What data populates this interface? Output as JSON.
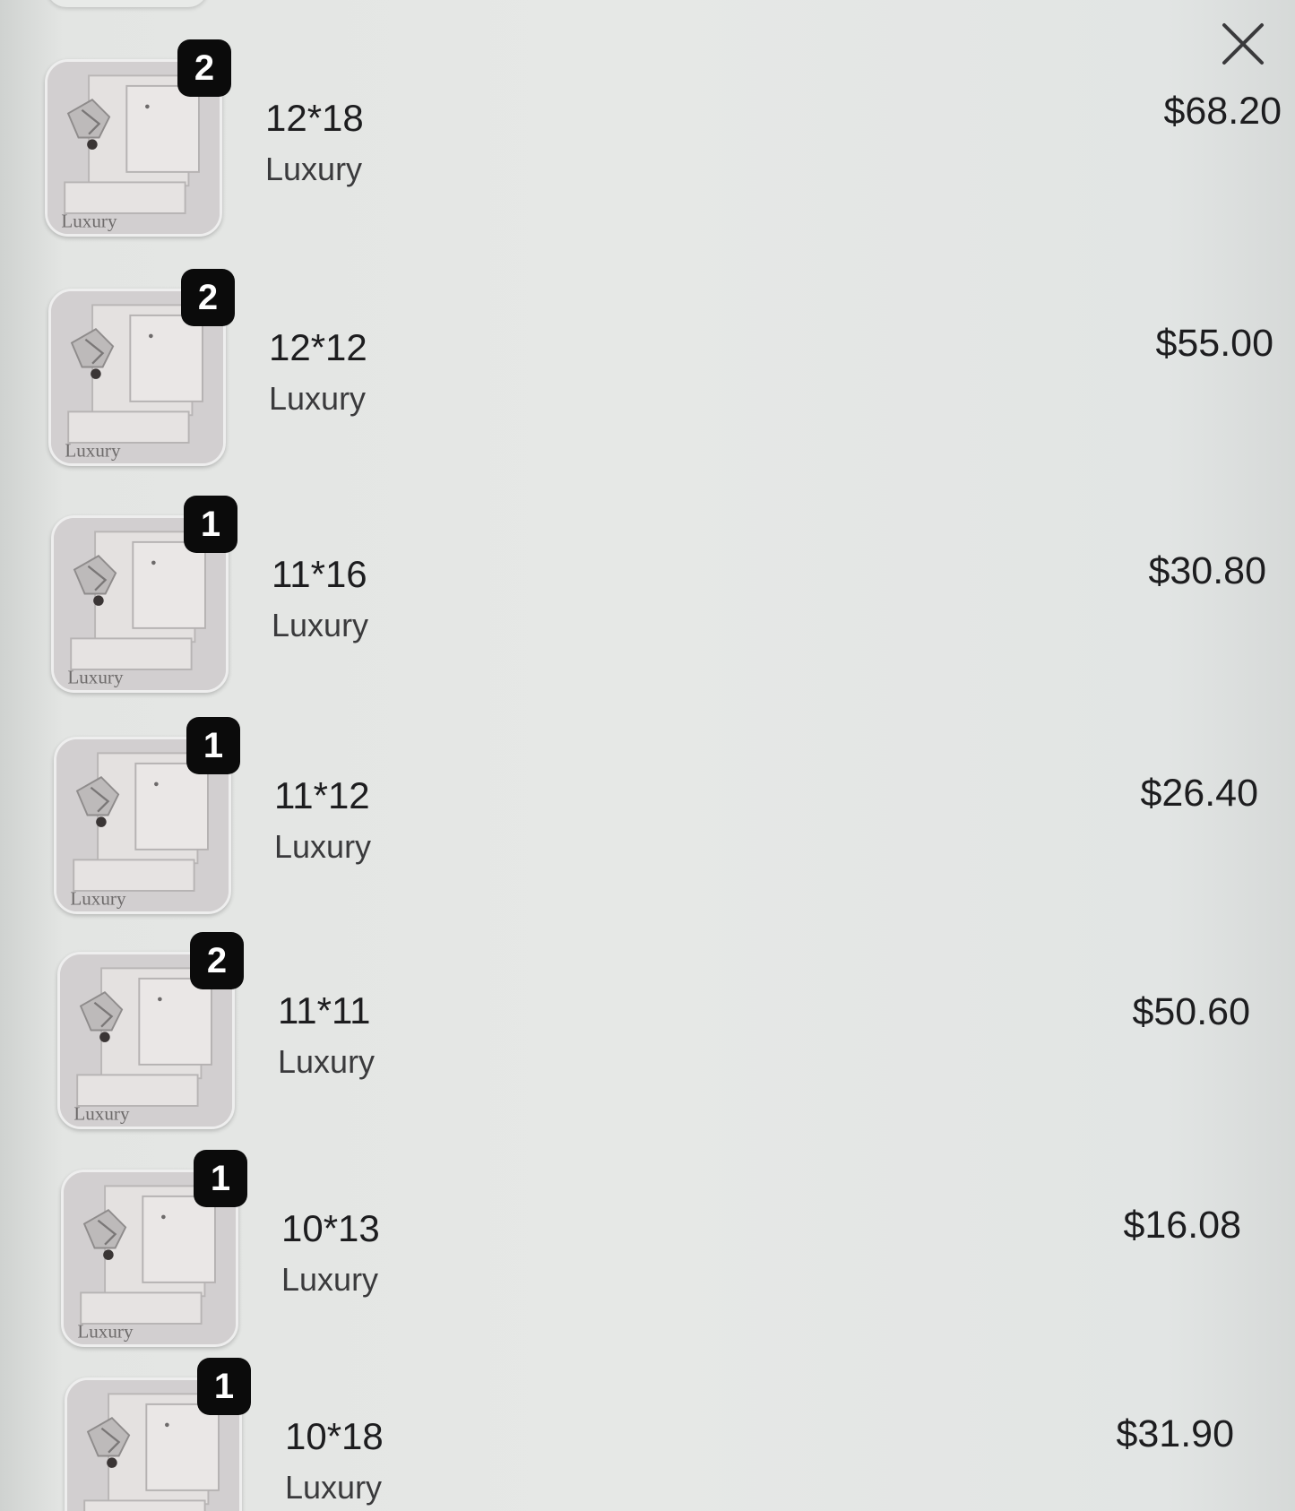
{
  "header": {
    "close_icon": "close-icon"
  },
  "thumbnail": {
    "icon": "product-thumbnail",
    "watermark_text": "Luxury"
  },
  "items": [
    {
      "size": "12*18",
      "tier": "Luxury",
      "quantity": "2",
      "price": "$68.20"
    },
    {
      "size": "12*12",
      "tier": "Luxury",
      "quantity": "2",
      "price": "$55.00"
    },
    {
      "size": "11*16",
      "tier": "Luxury",
      "quantity": "1",
      "price": "$30.80"
    },
    {
      "size": "11*12",
      "tier": "Luxury",
      "quantity": "1",
      "price": "$26.40"
    },
    {
      "size": "11*11",
      "tier": "Luxury",
      "quantity": "2",
      "price": "$50.60"
    },
    {
      "size": "10*13",
      "tier": "Luxury",
      "quantity": "1",
      "price": "$16.08"
    },
    {
      "size": "10*18",
      "tier": "Luxury",
      "quantity": "1",
      "price": "$31.90"
    }
  ],
  "colors": {
    "background": "#e3e5e3",
    "badge": "#0b0b0b",
    "text": "#1d1d1f"
  }
}
